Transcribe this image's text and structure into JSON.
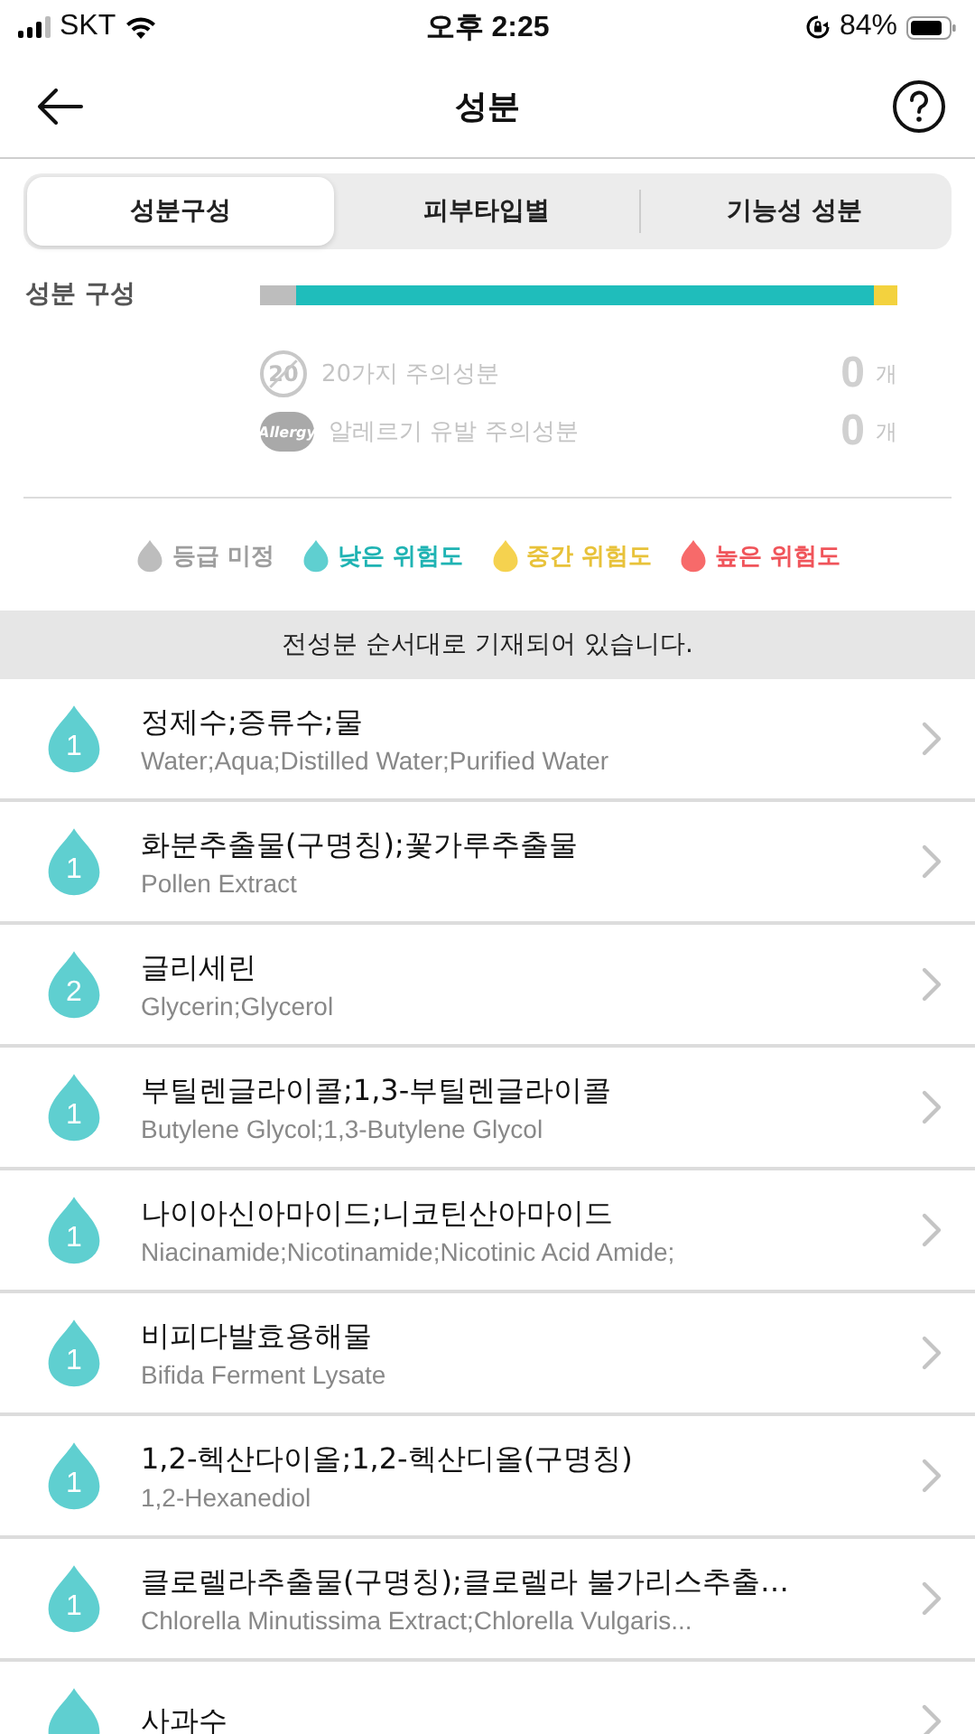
{
  "status_bar": {
    "carrier": "SKT",
    "time": "오후 2:25",
    "battery": "84%"
  },
  "header": {
    "title": "성분"
  },
  "tabs": [
    {
      "label": "성분구성",
      "selected": true
    },
    {
      "label": "피부타입별",
      "selected": false
    },
    {
      "label": "기능성 성분",
      "selected": false
    }
  ],
  "composition": {
    "label": "성분 구성",
    "segments": [
      {
        "kind": "unrated",
        "level": 0.057
      },
      {
        "kind": "low",
        "level": 0.963
      },
      {
        "kind": "medium",
        "level": 1
      }
    ],
    "cautions": [
      {
        "kind": "twenty",
        "icon_label": "20",
        "label": "20가지 주의성분",
        "count": "0",
        "unit": "개"
      },
      {
        "kind": "allergy",
        "icon_label": "Allergy",
        "label": "알레르기 유발 주의성분",
        "count": "0",
        "unit": "개"
      }
    ]
  },
  "legend": [
    {
      "kind": "unrated",
      "label": "등급 미정"
    },
    {
      "kind": "low",
      "label": "낮은 위험도"
    },
    {
      "kind": "medium",
      "label": "중간 위험도"
    },
    {
      "kind": "high",
      "label": "높은 위험도"
    }
  ],
  "notice": "전성분 순서대로 기재되어 있습니다.",
  "ingredients": [
    {
      "kind": "low",
      "grade": "1",
      "name": "정제수;증류수;물",
      "english": "Water;Aqua;Distilled Water;Purified Water"
    },
    {
      "kind": "low",
      "grade": "1",
      "name": "화분추출물(구명칭);꽃가루추출물",
      "english": "Pollen Extract"
    },
    {
      "kind": "low",
      "grade": "2",
      "name": "글리세린",
      "english": "Glycerin;Glycerol"
    },
    {
      "kind": "low",
      "grade": "1",
      "name": "부틸렌글라이콜;1,3-부틸렌글라이콜",
      "english": "Butylene Glycol;1,3-Butylene Glycol"
    },
    {
      "kind": "low",
      "grade": "1",
      "name": "나이아신아마이드;니코틴산아마이드",
      "english": "Niacinamide;Nicotinamide;Nicotinic Acid Amide;"
    },
    {
      "kind": "low",
      "grade": "1",
      "name": "비피다발효용해물",
      "english": "Bifida Ferment Lysate"
    },
    {
      "kind": "low",
      "grade": "1",
      "name": "1,2-헥산다이올;1,2-헥산디올(구명칭)",
      "english": "1,2-Hexanediol"
    },
    {
      "kind": "low",
      "grade": "1",
      "name": "클로렐라추출물(구명칭);클로렐라 불가리스추출…",
      "english": "Chlorella Minutissima Extract;Chlorella Vulgaris..."
    },
    {
      "kind": "low",
      "name": "사과수"
    }
  ]
}
